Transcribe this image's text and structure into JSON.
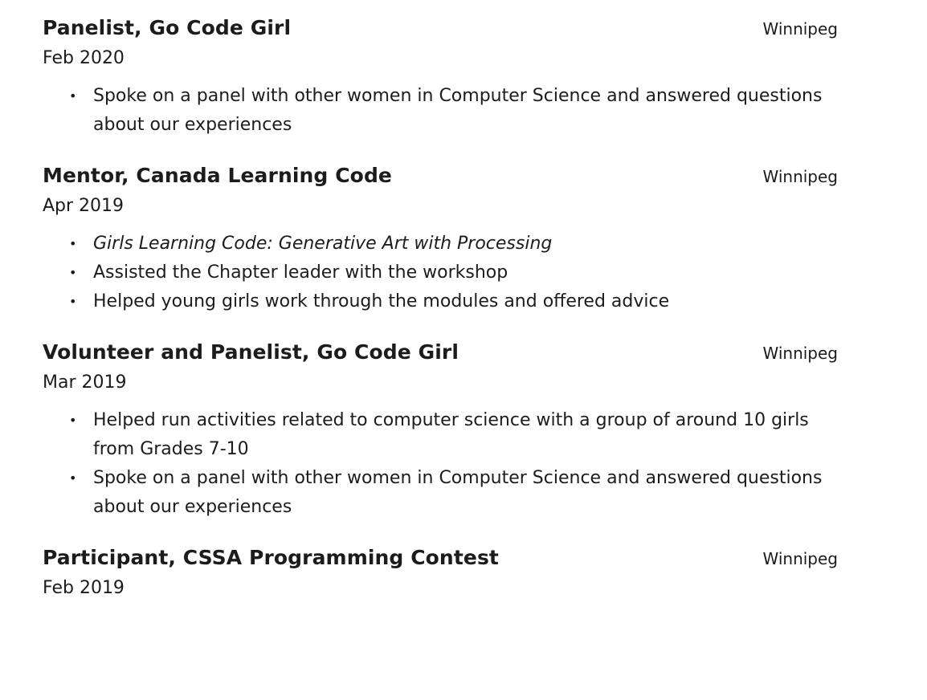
{
  "entries": [
    {
      "title": "Panelist, Go Code Girl",
      "location": "Winnipeg",
      "date": "Feb 2020",
      "bullets": [
        "Spoke on a panel with other women in Computer Science and answered questions about our experiences"
      ]
    },
    {
      "title": "Mentor, Canada Learning Code",
      "location": "Winnipeg",
      "date": "Apr 2019",
      "bullets": [
        "Girls Learning Code: Generative Art with Processing",
        "Assisted the Chapter leader with the workshop",
        "Helped young girls work through the modules and offered advice"
      ]
    },
    {
      "title": "Volunteer and Panelist, Go Code Girl",
      "location": "Winnipeg",
      "date": "Mar 2019",
      "bullets": [
        "Helped run activities related to computer science with a group of around 10 girls from Grades 7-10",
        "Spoke on a panel with other women in Computer Science and answered questions about our experiences"
      ]
    },
    {
      "title": "Participant, CSSA Programming Contest",
      "location": "Winnipeg",
      "date": "Feb 2019",
      "bullets": []
    }
  ]
}
